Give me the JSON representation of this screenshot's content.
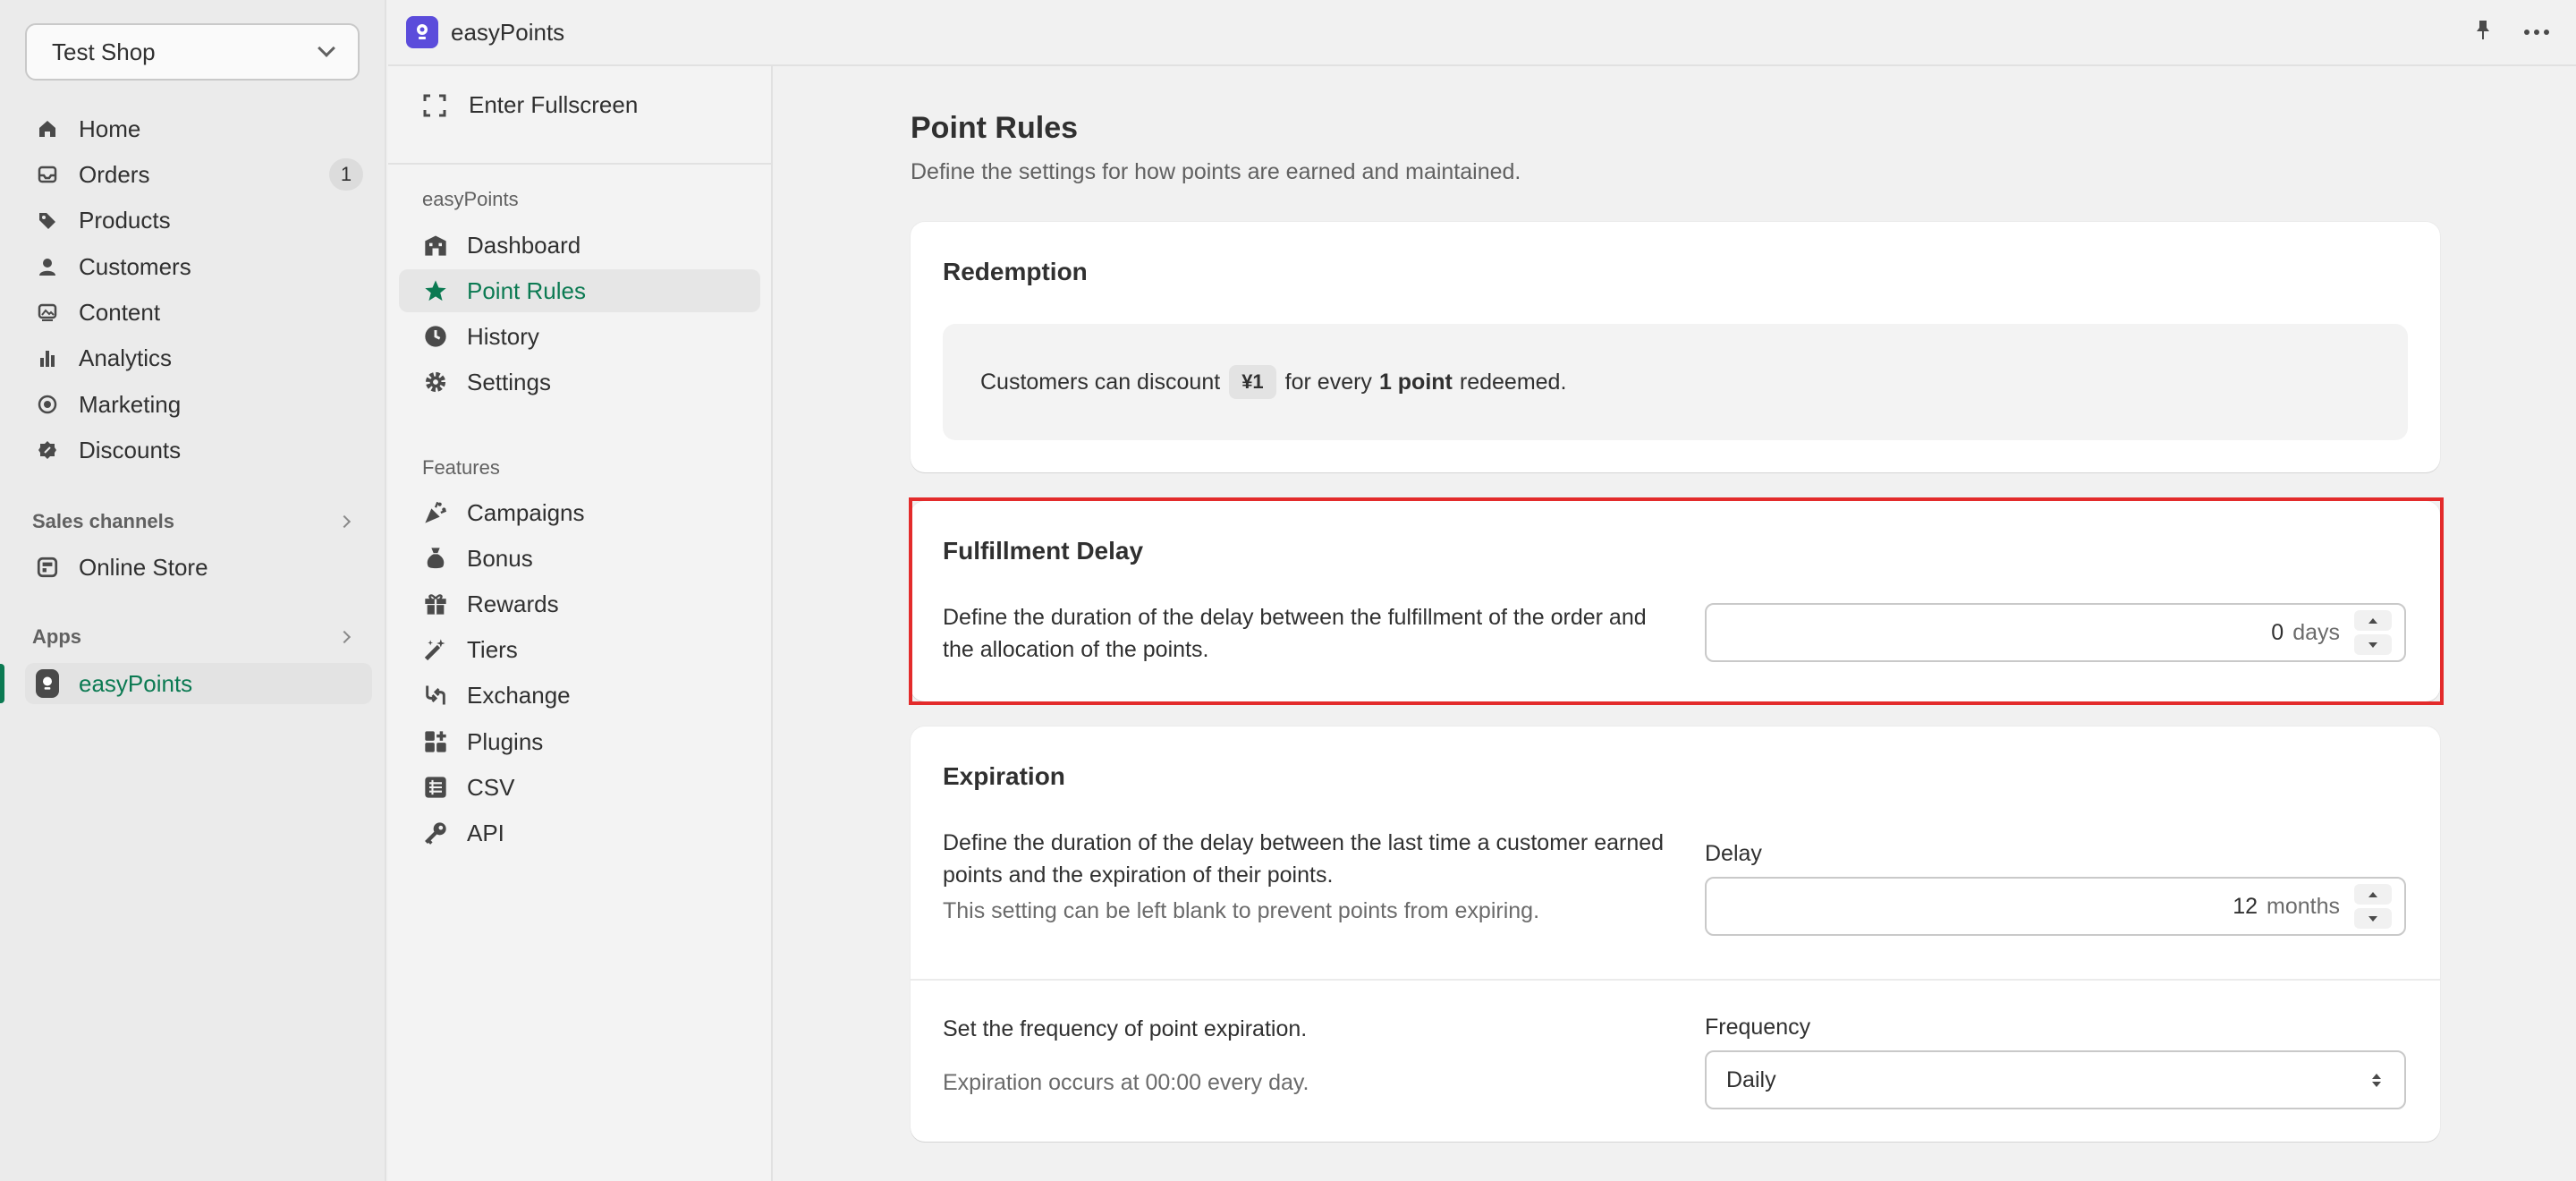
{
  "shop": {
    "name": "Test Shop"
  },
  "nav": {
    "items": [
      {
        "label": "Home",
        "icon": "home-icon"
      },
      {
        "label": "Orders",
        "icon": "inbox-icon",
        "badge": "1"
      },
      {
        "label": "Products",
        "icon": "tag-icon"
      },
      {
        "label": "Customers",
        "icon": "person-icon"
      },
      {
        "label": "Content",
        "icon": "image-icon"
      },
      {
        "label": "Analytics",
        "icon": "bar-chart-icon"
      },
      {
        "label": "Marketing",
        "icon": "target-icon"
      },
      {
        "label": "Discounts",
        "icon": "discount-icon"
      }
    ],
    "sales_channels_label": "Sales channels",
    "online_store": "Online Store",
    "apps_label": "Apps",
    "easypoints": "easyPoints"
  },
  "topbar": {
    "title": "easyPoints"
  },
  "app_nav": {
    "fullscreen": "Enter Fullscreen",
    "group1_label": "easyPoints",
    "group1": [
      {
        "label": "Dashboard",
        "icon": "building-icon"
      },
      {
        "label": "Point Rules",
        "icon": "star-icon"
      },
      {
        "label": "History",
        "icon": "clock-icon"
      },
      {
        "label": "Settings",
        "icon": "gear-icon"
      }
    ],
    "group2_label": "Features",
    "group2": [
      {
        "label": "Campaigns",
        "icon": "confetti-icon"
      },
      {
        "label": "Bonus",
        "icon": "bag-icon"
      },
      {
        "label": "Rewards",
        "icon": "gift-icon"
      },
      {
        "label": "Tiers",
        "icon": "magic-wand-icon"
      },
      {
        "label": "Exchange",
        "icon": "exchange-icon"
      },
      {
        "label": "Plugins",
        "icon": "apps-icon"
      },
      {
        "label": "CSV",
        "icon": "list-icon"
      },
      {
        "label": "API",
        "icon": "key-icon"
      }
    ]
  },
  "page": {
    "title": "Point Rules",
    "subtitle": "Define the settings for how points are earned and maintained."
  },
  "redemption": {
    "title": "Redemption",
    "text_before": "Customers can discount",
    "amount": "¥1",
    "text_mid": "for every",
    "points": "1 point",
    "text_after": "redeemed."
  },
  "fulfillment": {
    "title": "Fulfillment Delay",
    "description": "Define the duration of the delay between the fulfillment of the order and the allocation of the points.",
    "value": "0",
    "unit": "days"
  },
  "expiration": {
    "title": "Expiration",
    "description": "Define the duration of the delay between the last time a customer earned points and the expiration of their points.",
    "help": "This setting can be left blank to prevent points from expiring.",
    "delay_label": "Delay",
    "delay_value": "12",
    "delay_unit": "months",
    "frequency_description": "Set the frequency of point expiration.",
    "frequency_help": "Expiration occurs at 00:00 every day.",
    "frequency_label": "Frequency",
    "frequency_value": "Daily"
  },
  "colors": {
    "accent": "#0b7a52",
    "highlight": "#e32b2b",
    "logo": "#5b4cdb"
  }
}
